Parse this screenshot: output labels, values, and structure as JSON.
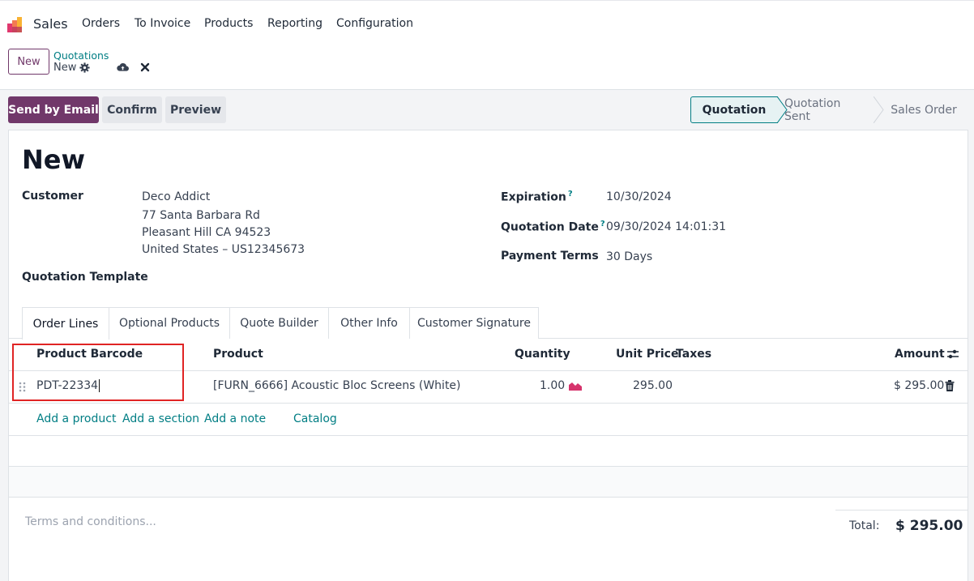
{
  "nav": {
    "app_name": "Sales",
    "menu": [
      "Orders",
      "To Invoice",
      "Products",
      "Reporting",
      "Configuration"
    ]
  },
  "breadcrumb": {
    "new_button": "New",
    "parent": "Quotations",
    "current": "New"
  },
  "actions": {
    "send_email": "Send by Email",
    "confirm": "Confirm",
    "preview": "Preview"
  },
  "status": {
    "stages": [
      "Quotation",
      "Quotation Sent",
      "Sales Order"
    ],
    "active": "Quotation"
  },
  "form": {
    "title": "New",
    "customer_label": "Customer",
    "customer_lines": [
      "Deco Addict",
      "77 Santa Barbara Rd",
      "Pleasant Hill CA 94523",
      "United States – US12345673"
    ],
    "template_label": "Quotation Template",
    "expiration_label": "Expiration",
    "expiration_value": "10/30/2024",
    "quote_date_label": "Quotation Date",
    "quote_date_value": "09/30/2024 14:01:31",
    "payment_terms_label": "Payment Terms",
    "payment_terms_value": "30 Days"
  },
  "tabs": [
    "Order Lines",
    "Optional Products",
    "Quote Builder",
    "Other Info",
    "Customer Signature"
  ],
  "table": {
    "headers": {
      "barcode": "Product Barcode",
      "product": "Product",
      "quantity": "Quantity",
      "unit_price": "Unit Price",
      "taxes": "Taxes",
      "amount": "Amount"
    },
    "row": {
      "barcode": "PDT-22334",
      "product": "[FURN_6666] Acoustic Bloc Screens (White)",
      "quantity": "1.00",
      "unit_price": "295.00",
      "amount": "$ 295.00"
    },
    "add_links": [
      "Add a product",
      "Add a section",
      "Add a note",
      "Catalog"
    ]
  },
  "footer": {
    "terms_placeholder": "Terms and conditions...",
    "total_label": "Total:",
    "total_value": "$ 295.00"
  },
  "colors": {
    "brand": "#71386a",
    "accent": "#017e84",
    "highlight_box": "#e02424"
  }
}
